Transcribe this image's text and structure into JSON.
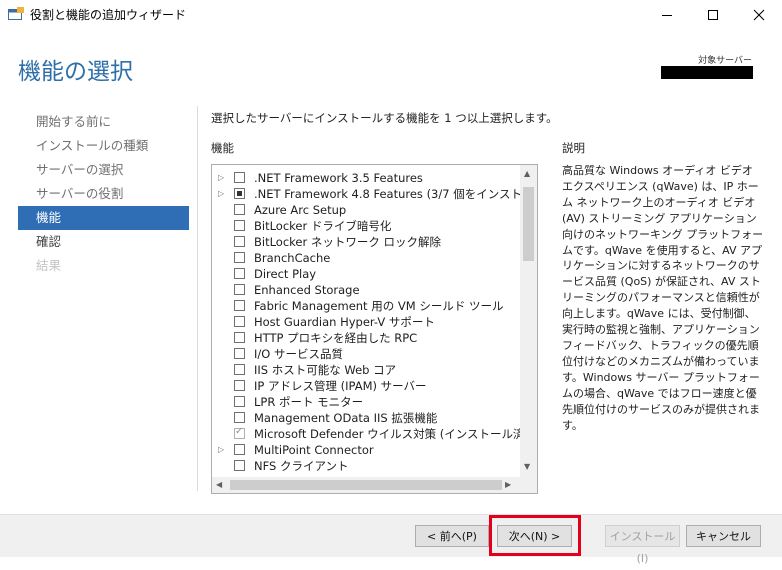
{
  "window": {
    "title": "役割と機能の追加ウィザード",
    "minimize_icon": "minimize-icon",
    "maximize_icon": "maximize-icon",
    "close_icon": "close-icon"
  },
  "page": {
    "heading": "機能の選択",
    "target_server_label": "対象サーバー"
  },
  "steps": [
    {
      "label": "開始する前に",
      "state": "normal"
    },
    {
      "label": "インストールの種類",
      "state": "normal"
    },
    {
      "label": "サーバーの選択",
      "state": "normal"
    },
    {
      "label": "サーバーの役割",
      "state": "normal"
    },
    {
      "label": "機能",
      "state": "active"
    },
    {
      "label": "確認",
      "state": "normal"
    },
    {
      "label": "結果",
      "state": "disabled"
    }
  ],
  "main": {
    "instruction": "選択したサーバーにインストールする機能を 1 つ以上選択します。",
    "features_label": "機能",
    "description_label": "説明",
    "description": "高品質な Windows オーディオ ビデオ エクスペリエンス (qWave) は、IP ホーム ネットワーク上のオーディオ ビデオ (AV) ストリーミング アプリケーション向けのネットワーキング プラットフォームです。qWave を使用すると、AV アプリケーションに対するネットワークのサービス品質 (QoS) が保証され、AV ストリーミングのパフォーマンスと信頼性が向上します。qWave には、受付制御、実行時の監視と強制、アプリケーション フィードバック、トラフィックの優先順位付けなどのメカニズムが備わっています。Windows サーバー プラットフォームの場合、qWave ではフロー速度と優先順位付けのサービスのみが提供されます。"
  },
  "features": [
    {
      "label": ".NET Framework 3.5 Features",
      "expandable": true,
      "state": "unchecked"
    },
    {
      "label": ".NET Framework 4.8 Features (3/7 個をインストール済",
      "expandable": true,
      "state": "partial"
    },
    {
      "label": "Azure Arc Setup",
      "expandable": false,
      "state": "unchecked"
    },
    {
      "label": "BitLocker ドライブ暗号化",
      "expandable": false,
      "state": "unchecked"
    },
    {
      "label": "BitLocker ネットワーク ロック解除",
      "expandable": false,
      "state": "unchecked"
    },
    {
      "label": "BranchCache",
      "expandable": false,
      "state": "unchecked"
    },
    {
      "label": "Direct Play",
      "expandable": false,
      "state": "unchecked"
    },
    {
      "label": "Enhanced Storage",
      "expandable": false,
      "state": "unchecked"
    },
    {
      "label": "Fabric Management 用の VM シールド ツール",
      "expandable": false,
      "state": "unchecked"
    },
    {
      "label": "Host Guardian Hyper-V サポート",
      "expandable": false,
      "state": "unchecked"
    },
    {
      "label": "HTTP プロキシを経由した RPC",
      "expandable": false,
      "state": "unchecked"
    },
    {
      "label": "I/O サービス品質",
      "expandable": false,
      "state": "unchecked"
    },
    {
      "label": "IIS ホスト可能な Web コア",
      "expandable": false,
      "state": "unchecked"
    },
    {
      "label": "IP アドレス管理 (IPAM) サーバー",
      "expandable": false,
      "state": "unchecked"
    },
    {
      "label": "LPR ポート モニター",
      "expandable": false,
      "state": "unchecked"
    },
    {
      "label": "Management OData IIS 拡張機能",
      "expandable": false,
      "state": "unchecked"
    },
    {
      "label": "Microsoft Defender ウイルス対策 (インストール済み)",
      "expandable": false,
      "state": "checked-disabled"
    },
    {
      "label": "MultiPoint Connector",
      "expandable": true,
      "state": "unchecked"
    },
    {
      "label": "NFS クライアント",
      "expandable": false,
      "state": "unchecked"
    }
  ],
  "buttons": {
    "prev": "< 前へ(P)",
    "next": "次へ(N) >",
    "install": "インストール(I)",
    "cancel": "キャンセル"
  },
  "colors": {
    "heading": "#2e6fa8",
    "active_step": "#2f6db5",
    "highlight": "#e4001d"
  }
}
